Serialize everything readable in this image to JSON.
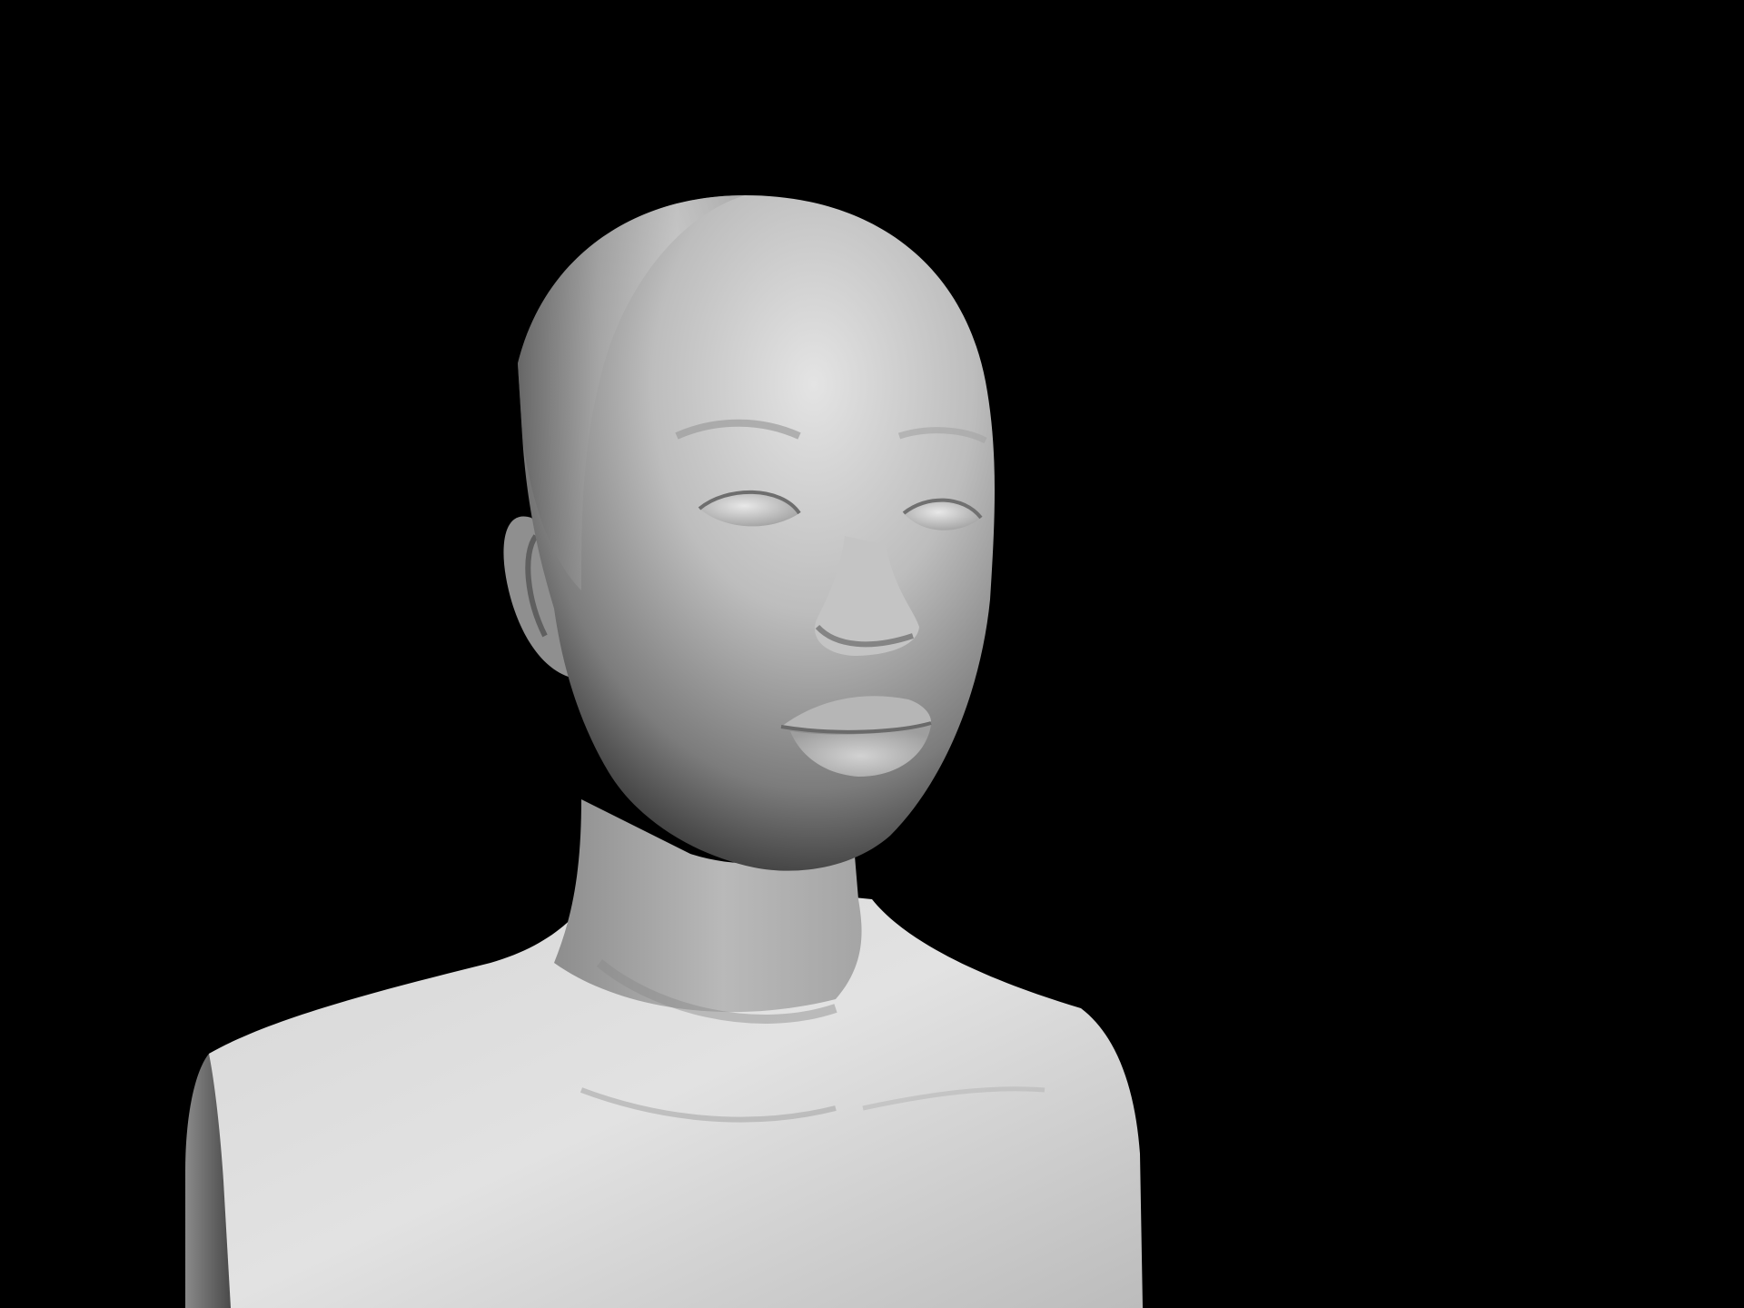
{
  "scene": {
    "kind": "3d-sculpt-render",
    "subject": "bust",
    "background_color": "#000000",
    "material_color": "#c8c8c8",
    "highlight_color": "#e6e6e6",
    "shadow_color": "#6a6a6a"
  }
}
